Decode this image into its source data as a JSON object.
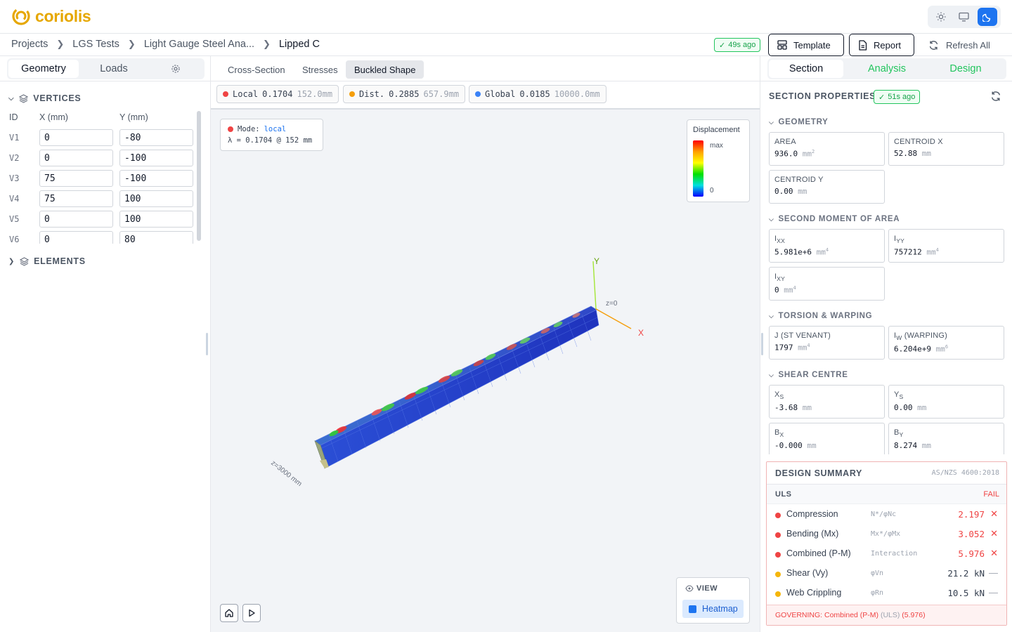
{
  "app": {
    "name": "coriolis"
  },
  "theme_buttons": [
    {
      "icon": "sun-icon",
      "active": false
    },
    {
      "icon": "monitor-icon",
      "active": false
    },
    {
      "icon": "moon-icon",
      "active": true
    }
  ],
  "breadcrumb": [
    "Projects",
    "LGS Tests",
    "Light Gauge Steel Ana...",
    "Lipped C"
  ],
  "toolbar": {
    "saved_badge": "49s ago",
    "template_label": "Template",
    "report_label": "Report",
    "refresh_label": "Refresh All"
  },
  "left": {
    "tabs": [
      "Geometry",
      "Loads"
    ],
    "active_tab": "Geometry",
    "vertices_title": "VERTICES",
    "elements_title": "ELEMENTS",
    "columns": [
      "ID",
      "X (mm)",
      "Y (mm)"
    ],
    "vertices": [
      {
        "id": "V1",
        "x": "0",
        "y": "-80"
      },
      {
        "id": "V2",
        "x": "0",
        "y": "-100"
      },
      {
        "id": "V3",
        "x": "75",
        "y": "-100"
      },
      {
        "id": "V4",
        "x": "75",
        "y": "100"
      },
      {
        "id": "V5",
        "x": "0",
        "y": "100"
      },
      {
        "id": "V6",
        "x": "0",
        "y": "80"
      }
    ]
  },
  "center": {
    "tabs": [
      "Cross-Section",
      "Stresses",
      "Buckled Shape"
    ],
    "active_tab": "Buckled Shape",
    "modes": [
      {
        "label": "Local",
        "value": "0.1704",
        "length": "152.0mm",
        "color": "#ef4444"
      },
      {
        "label": "Dist.",
        "value": "0.2885",
        "length": "657.9mm",
        "color": "#f59e0b"
      },
      {
        "label": "Global",
        "value": "0.0185",
        "length": "10000.0mm",
        "color": "#3b82f6"
      }
    ],
    "info": {
      "mode_label": "Mode:",
      "mode_value": "local",
      "lambda_line": "λ = 0.1704 @ 152 mm"
    },
    "legend": {
      "title": "Displacement",
      "max": "max",
      "min": "0"
    },
    "axes": {
      "y": "Y",
      "x": "X",
      "z0": "z=0",
      "length": "z=3000 mm"
    },
    "view": {
      "title": "VIEW",
      "heatmap_label": "Heatmap"
    }
  },
  "right": {
    "tabs": [
      "Section",
      "Analysis",
      "Design"
    ],
    "active_tab": "Section",
    "section_title": "SECTION PROPERTIES",
    "section_badge": "51s ago",
    "groups": [
      {
        "title": "GEOMETRY",
        "props": [
          {
            "label": "AREA",
            "value": "936.0",
            "unit": "mm",
            "sup": "2"
          },
          {
            "label": "CENTROID X",
            "value": "52.88",
            "unit": "mm",
            "sup": ""
          },
          {
            "label": "CENTROID Y",
            "value": "0.00",
            "unit": "mm",
            "sup": ""
          }
        ]
      },
      {
        "title": "SECOND MOMENT OF AREA",
        "props": [
          {
            "label": "I",
            "sub": "XX",
            "value": "5.981e+6",
            "unit": "mm",
            "sup": "4"
          },
          {
            "label": "I",
            "sub": "YY",
            "value": "757212",
            "unit": "mm",
            "sup": "4"
          },
          {
            "label": "I",
            "sub": "XY",
            "value": "0",
            "unit": "mm",
            "sup": "4"
          }
        ]
      },
      {
        "title": "TORSION & WARPING",
        "props": [
          {
            "label": "J (ST VENANT)",
            "value": "1797",
            "unit": "mm",
            "sup": "4"
          },
          {
            "label": "I",
            "sub": "W",
            "label2": " (WARPING)",
            "value": "6.204e+9",
            "unit": "mm",
            "sup": "6"
          }
        ]
      },
      {
        "title": "SHEAR CENTRE",
        "props": [
          {
            "label": "X",
            "sub": "S",
            "value": "-3.68",
            "unit": "mm",
            "sup": ""
          },
          {
            "label": "Y",
            "sub": "S",
            "value": "0.00",
            "unit": "mm",
            "sup": ""
          },
          {
            "label": "B",
            "sub": "X",
            "value": "-0.000",
            "unit": "mm",
            "sup": ""
          },
          {
            "label": "B",
            "sub": "Y",
            "value": "8.274",
            "unit": "mm",
            "sup": ""
          }
        ]
      }
    ]
  },
  "design_summary": {
    "title": "DESIGN SUMMARY",
    "standard": "AS/NZS 4600:2018",
    "uls_label": "ULS",
    "uls_status": "FAIL",
    "rows": [
      {
        "name": "Compression",
        "formula": "N*/φNc",
        "value": "2.197",
        "mark": "✕",
        "status": "fail"
      },
      {
        "name": "Bending (Mx)",
        "formula": "Mx*/φMx",
        "value": "3.052",
        "mark": "✕",
        "status": "fail"
      },
      {
        "name": "Combined (P-M)",
        "formula": "Interaction",
        "value": "5.976",
        "mark": "✕",
        "status": "fail"
      },
      {
        "name": "Shear (Vy)",
        "formula": "φVn",
        "value": "21.2 kN",
        "mark": "—",
        "status": "info"
      },
      {
        "name": "Web Crippling",
        "formula": "φRn",
        "value": "10.5 kN",
        "mark": "—",
        "status": "info"
      }
    ],
    "governing_label": "GOVERNING: Combined (P-M)",
    "governing_case": "(ULS)",
    "governing_value": "(5.976)"
  },
  "colors": {
    "brand": "#e6a700",
    "accent": "#1d74f0",
    "success": "#22c55e",
    "fail": "#ef4444",
    "warn": "#f59e0b"
  }
}
